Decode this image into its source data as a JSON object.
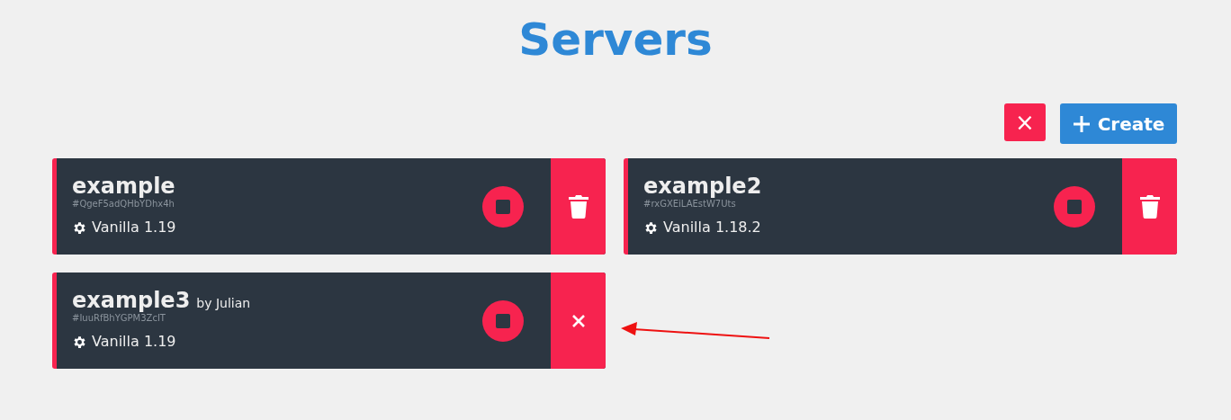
{
  "title": "Servers",
  "toolbar": [
    {
      "kind": "cancel",
      "label": "×"
    },
    {
      "kind": "create",
      "label": "Create"
    }
  ],
  "servers": [
    {
      "name": "example",
      "id": "#QgeF5adQHbYDhx4h",
      "version": "Vanilla 1.19",
      "action": {
        "kind": "delete"
      }
    },
    {
      "name": "example2",
      "id": "#rxGXEiLAEstW7Uts",
      "version": "Vanilla 1.18.2",
      "action": {
        "kind": "delete"
      }
    },
    {
      "name": "example3",
      "owner": "by Julian",
      "id": "#IuuRfBhYGPM3ZcIT",
      "version": "Vanilla 1.19",
      "action": {
        "kind": "cancel"
      }
    }
  ],
  "annotations": [
    {
      "kind": "arrow"
    }
  ]
}
